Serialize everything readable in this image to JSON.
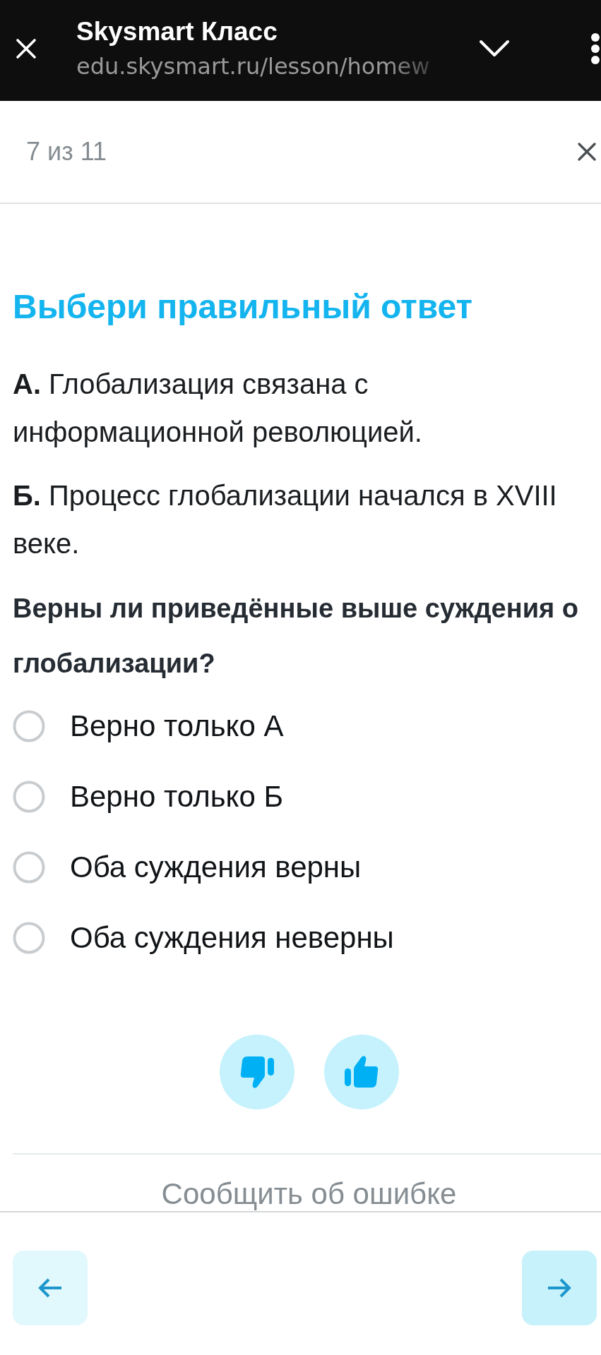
{
  "browser_bar": {
    "title": "Skysmart Класс",
    "url": "edu.skysmart.ru/lesson/homew"
  },
  "task_header": {
    "counter": "7 из 11"
  },
  "task": {
    "heading": "Выбери правильный ответ",
    "statements": [
      "**А.** Глобализация связана с информационной революцией.",
      "**Б.** Процесс глобализации начался в XVIII веке."
    ],
    "question": "Верны ли приведённые выше суждения о глобализации?",
    "options": [
      {
        "label": "Верно только А",
        "selected": false
      },
      {
        "label": "Верно только Б",
        "selected": false
      },
      {
        "label": "Оба суждения верны",
        "selected": false
      },
      {
        "label": "Оба суждения неверны",
        "selected": false
      }
    ]
  },
  "feedback": [
    {
      "kind": "dislike"
    },
    {
      "kind": "like"
    }
  ],
  "report_link": "Сообщить об ошибке",
  "navigation": [
    {
      "kind": "back"
    },
    {
      "kind": "next"
    }
  ]
}
